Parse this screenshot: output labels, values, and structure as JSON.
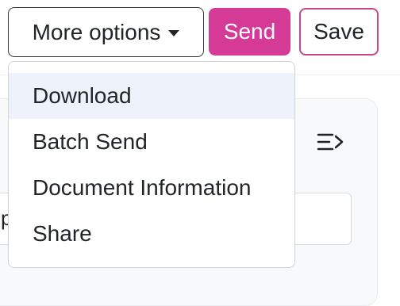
{
  "toolbar": {
    "more_options_label": "More options",
    "send_label": "Send",
    "save_label": "Save"
  },
  "dropdown": {
    "items": [
      {
        "label": "Download",
        "active": true
      },
      {
        "label": "Batch Send"
      },
      {
        "label": "Document Information"
      },
      {
        "label": "Share"
      }
    ]
  },
  "panel": {
    "input_partial_text": "p",
    "icon": "collapse-panel-icon"
  },
  "colors": {
    "accent": "#d63a97",
    "save_border": "#c8458f",
    "dropdown_hover": "#eef3fb"
  }
}
